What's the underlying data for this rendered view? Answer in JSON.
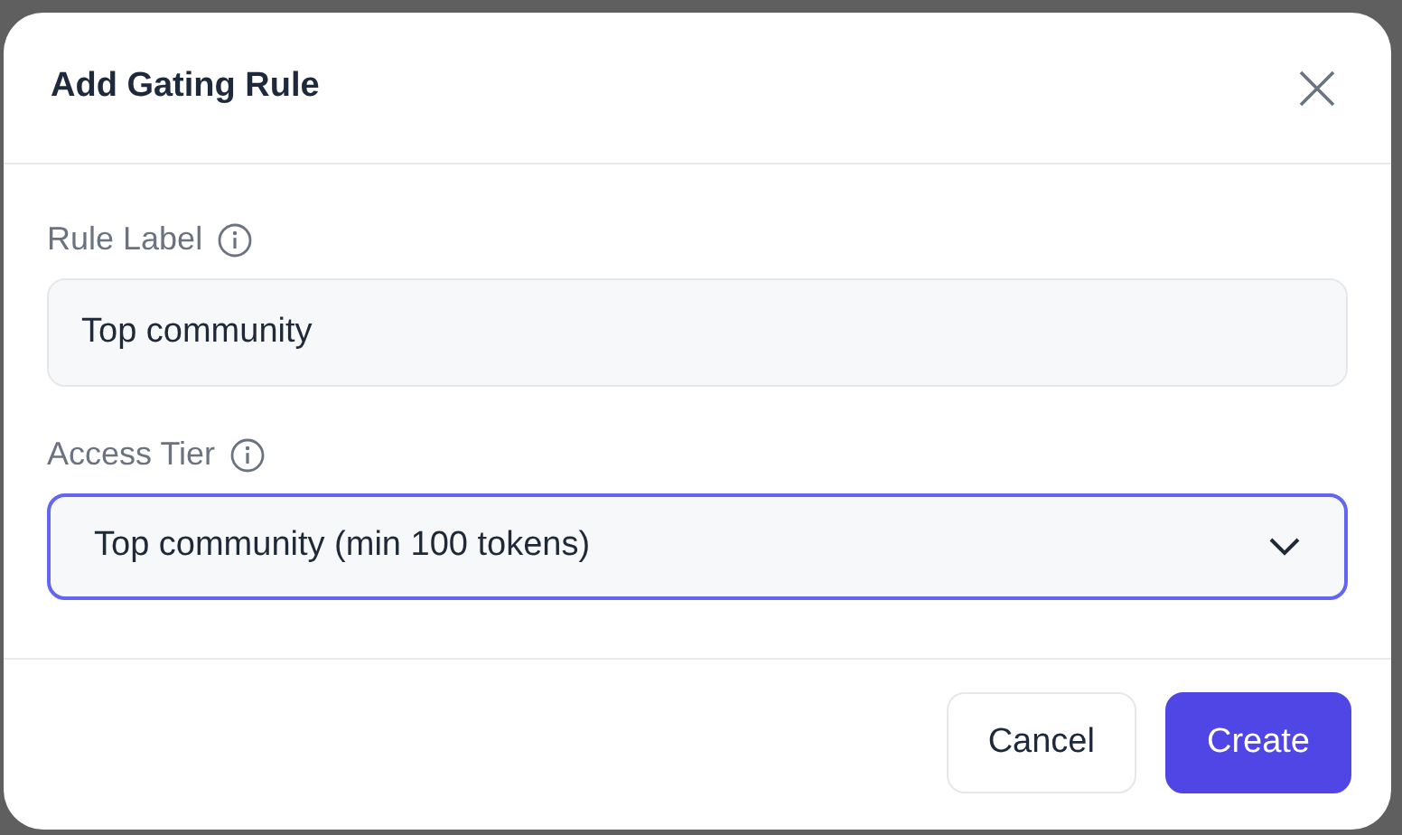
{
  "dialog": {
    "title": "Add Gating Rule"
  },
  "fields": [
    {
      "kind": "text",
      "label": "Rule Label",
      "value": "Top community",
      "focused": false
    },
    {
      "kind": "select",
      "label": "Access Tier",
      "value": "Top community (min 100 tokens)",
      "focused": true
    }
  ],
  "buttons": [
    {
      "label": "Cancel",
      "kind": "secondary"
    },
    {
      "label": "Create",
      "kind": "primary"
    }
  ]
}
